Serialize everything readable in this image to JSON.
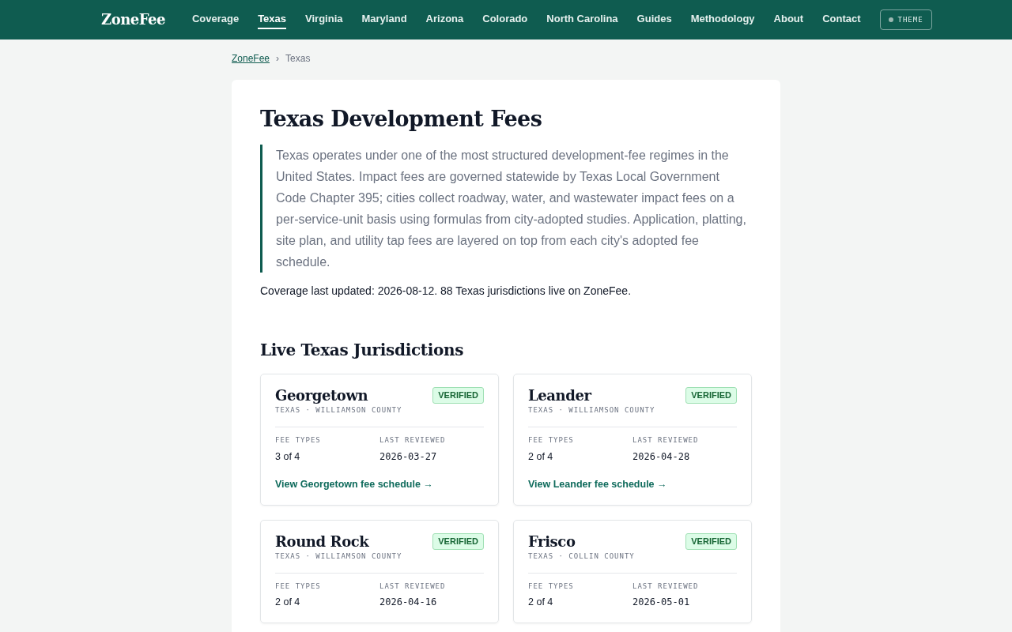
{
  "navbar": {
    "brand": "ZoneFee",
    "links": [
      {
        "label": "Coverage",
        "selected": false
      },
      {
        "label": "Texas",
        "selected": true
      },
      {
        "label": "Virginia",
        "selected": false
      },
      {
        "label": "Maryland",
        "selected": false
      },
      {
        "label": "Arizona",
        "selected": false
      },
      {
        "label": "Colorado",
        "selected": false
      },
      {
        "label": "North Carolina",
        "selected": false
      },
      {
        "label": "Guides",
        "selected": false
      },
      {
        "label": "Methodology",
        "selected": false
      },
      {
        "label": "About",
        "selected": false
      },
      {
        "label": "Contact",
        "selected": false
      }
    ],
    "theme_button": "THEME"
  },
  "breadcrumb": [
    {
      "label": "ZoneFee",
      "kind": "link"
    },
    {
      "label": "›",
      "kind": "separator"
    },
    {
      "label": "Texas",
      "kind": "current"
    }
  ],
  "title": "Texas Development Fees",
  "intro": "Texas operates under one of the most structured development-fee regimes in the United States. Impact fees are governed statewide by Texas Local Government Code Chapter 395; cities collect roadway, water, and wastewater impact fees on a per-service-unit basis using formulas from city-adopted studies. Application, platting, site plan, and utility tap fees are layered on top from each city's adopted fee schedule.",
  "coverage_note": "Coverage last updated: 2026-08-12. 88 Texas jurisdictions live on ZoneFee.",
  "section_title": "Live Texas Jurisdictions",
  "jurisdictions": [
    {
      "name": "Georgetown",
      "badge": "VERIFIED",
      "location": "TEXAS · WILLIAMSON COUNTY",
      "fee_types_label": "FEE TYPES",
      "fee_types": "3 of 4",
      "reviewed_label": "LAST REVIEWED",
      "reviewed": "2026-03-27",
      "link": "View Georgetown fee schedule →"
    },
    {
      "name": "Leander",
      "badge": "VERIFIED",
      "location": "TEXAS · WILLIAMSON COUNTY",
      "fee_types_label": "FEE TYPES",
      "fee_types": "2 of 4",
      "reviewed_label": "LAST REVIEWED",
      "reviewed": "2026-04-28",
      "link": "View Leander fee schedule →"
    },
    {
      "name": "Round Rock",
      "badge": "VERIFIED",
      "location": "TEXAS · WILLIAMSON COUNTY",
      "fee_types_label": "FEE TYPES",
      "fee_types": "2 of 4",
      "reviewed_label": "LAST REVIEWED",
      "reviewed": "2026-04-16"
    },
    {
      "name": "Frisco",
      "badge": "VERIFIED",
      "location": "TEXAS · COLLIN COUNTY",
      "fee_types_label": "FEE TYPES",
      "fee_types": "2 of 4",
      "reviewed_label": "LAST REVIEWED",
      "reviewed": "2026-05-01"
    }
  ]
}
